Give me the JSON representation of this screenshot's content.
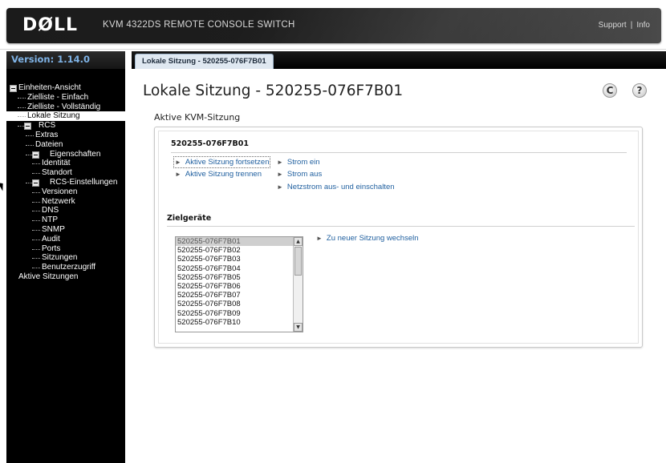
{
  "header": {
    "logo": "DØLL",
    "product": "KVM 4322DS REMOTE CONSOLE SWITCH",
    "support_label": "Support",
    "separator": "|",
    "info_label": "Info"
  },
  "sidebar": {
    "version": "Version: 1.14.0",
    "tree": [
      {
        "label": "Einheiten-Ansicht",
        "indent": 0,
        "toggle": true,
        "selected": false
      },
      {
        "label": "Zielliste - Einfach",
        "indent": 1,
        "toggle": false,
        "selected": false
      },
      {
        "label": "Zielliste - Vollständig",
        "indent": 1,
        "toggle": false,
        "selected": false
      },
      {
        "label": "Lokale Sitzung",
        "indent": 1,
        "toggle": false,
        "selected": true
      },
      {
        "label": "RCS",
        "indent": 1,
        "toggle": true,
        "selected": false
      },
      {
        "label": "Extras",
        "indent": 2,
        "toggle": false,
        "selected": false
      },
      {
        "label": "Dateien",
        "indent": 2,
        "toggle": false,
        "selected": false
      },
      {
        "label": "Eigenschaften",
        "indent": 2,
        "toggle": true,
        "selected": false
      },
      {
        "label": "Identität",
        "indent": 3,
        "toggle": false,
        "selected": false
      },
      {
        "label": "Standort",
        "indent": 3,
        "toggle": false,
        "selected": false
      },
      {
        "label": "RCS-Einstellungen",
        "indent": 2,
        "toggle": true,
        "selected": false
      },
      {
        "label": "Versionen",
        "indent": 3,
        "toggle": false,
        "selected": false
      },
      {
        "label": "Netzwerk",
        "indent": 3,
        "toggle": false,
        "selected": false
      },
      {
        "label": "DNS",
        "indent": 3,
        "toggle": false,
        "selected": false
      },
      {
        "label": "NTP",
        "indent": 3,
        "toggle": false,
        "selected": false
      },
      {
        "label": "SNMP",
        "indent": 3,
        "toggle": false,
        "selected": false
      },
      {
        "label": "Audit",
        "indent": 3,
        "toggle": false,
        "selected": false
      },
      {
        "label": "Ports",
        "indent": 3,
        "toggle": false,
        "selected": false
      },
      {
        "label": "Sitzungen",
        "indent": 3,
        "toggle": false,
        "selected": false
      },
      {
        "label": "Benutzerzugriff",
        "indent": 3,
        "toggle": false,
        "selected": false
      },
      {
        "label": "Aktive Sitzungen",
        "indent": 0,
        "toggle": false,
        "selected": false
      }
    ]
  },
  "tab": {
    "label": "Lokale Sitzung - 520255-076F7B01"
  },
  "main": {
    "title": "Lokale Sitzung - 520255-076F7B01",
    "refresh_glyph": "C",
    "help_glyph": "?",
    "section_title": "Aktive KVM-Sitzung",
    "device_id": "520255-076F7B01",
    "actions_left": [
      "Aktive Sitzung fortsetzen",
      "Aktive Sitzung trennen"
    ],
    "actions_right": [
      "Strom ein",
      "Strom aus",
      "Netzstrom aus- und einschalten"
    ],
    "targets_title": "Zielgeräte",
    "targets": [
      "520255-076F7B01",
      "520255-076F7B02",
      "520255-076F7B03",
      "520255-076F7B04",
      "520255-076F7B05",
      "520255-076F7B06",
      "520255-076F7B07",
      "520255-076F7B08",
      "520255-076F7B09",
      "520255-076F7B10"
    ],
    "switch_action": "Zu neuer Sitzung wechseln"
  }
}
